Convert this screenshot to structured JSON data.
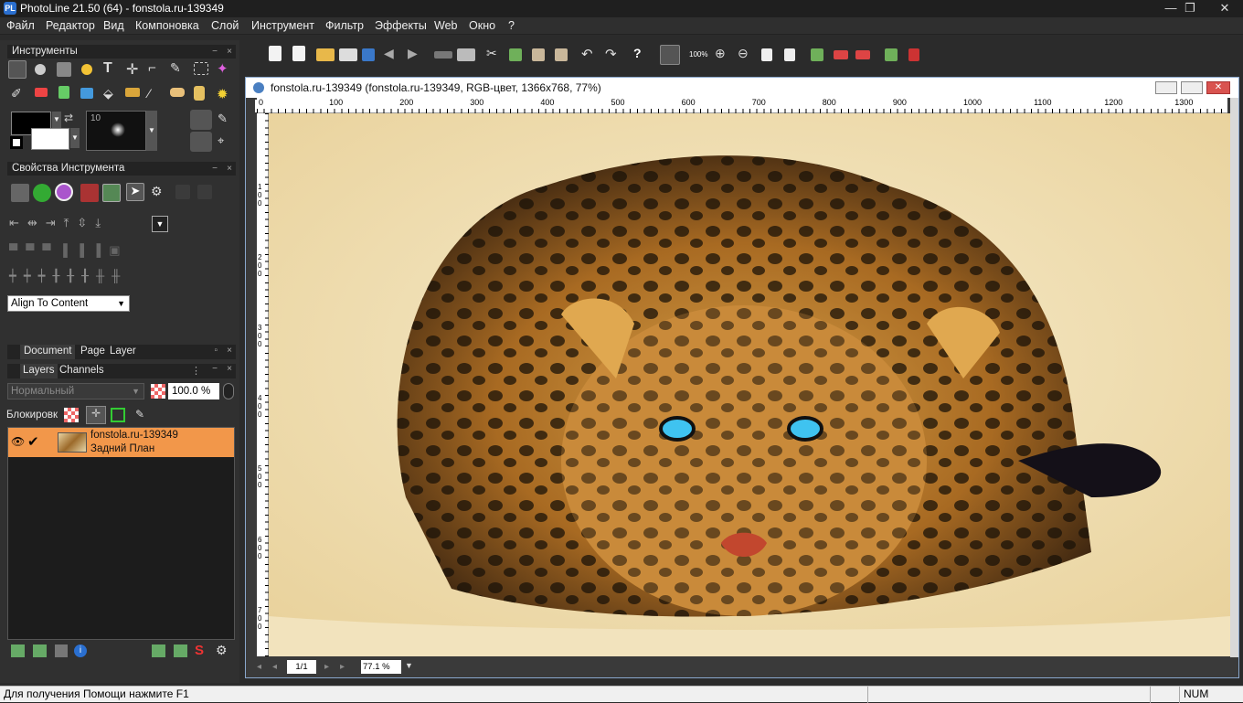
{
  "app": {
    "title": "PhotoLine 21.50 (64) - fonstola.ru-139349",
    "logo": "PL",
    "minimize": "—",
    "maximize": "❐",
    "close": "✕"
  },
  "menu": [
    "Файл",
    "Редактор",
    "Вид",
    "Компоновка",
    "Слой",
    "Инструмент",
    "Фильтр",
    "Эффекты",
    "Web",
    "Окно",
    "?"
  ],
  "toolbar": {
    "zoom_label": "100%"
  },
  "panels": {
    "tools": {
      "title": "Инструменты",
      "brush_size": "10"
    },
    "tool_props": {
      "title": "Свойства Инструмента",
      "align_select": "Align To Content"
    },
    "doc_tabs": [
      "Document",
      "Page",
      "Layer"
    ],
    "layer_tabs": [
      "Layers",
      "Channels"
    ],
    "blend_mode": "Нормальный",
    "opacity": "100.0 %",
    "lock_label": "Блокировк",
    "layer": {
      "name": "fonstola.ru-139349",
      "sub": "Задний План"
    },
    "min": "−",
    "close": "×"
  },
  "document": {
    "title": "fonstola.ru-139349 (fonstola.ru-139349, RGB-цвет, 1366x768, 77%)",
    "ruler_top": [
      "0",
      "100",
      "200",
      "300",
      "400",
      "500",
      "600",
      "700",
      "800",
      "900",
      "1000",
      "1100",
      "1200",
      "1300"
    ],
    "ruler_left": [
      "100",
      "200",
      "300",
      "400",
      "500",
      "600",
      "700"
    ],
    "page": "1/1",
    "zoom": "77.1 %"
  },
  "status": {
    "help": "Для получения Помощи нажмите F1",
    "num": "NUM"
  },
  "colors": {
    "accent": "#f2974a",
    "canvas_bg": "#efe2bd",
    "fur": "#b87a2c",
    "eye": "#3fc3f0"
  }
}
